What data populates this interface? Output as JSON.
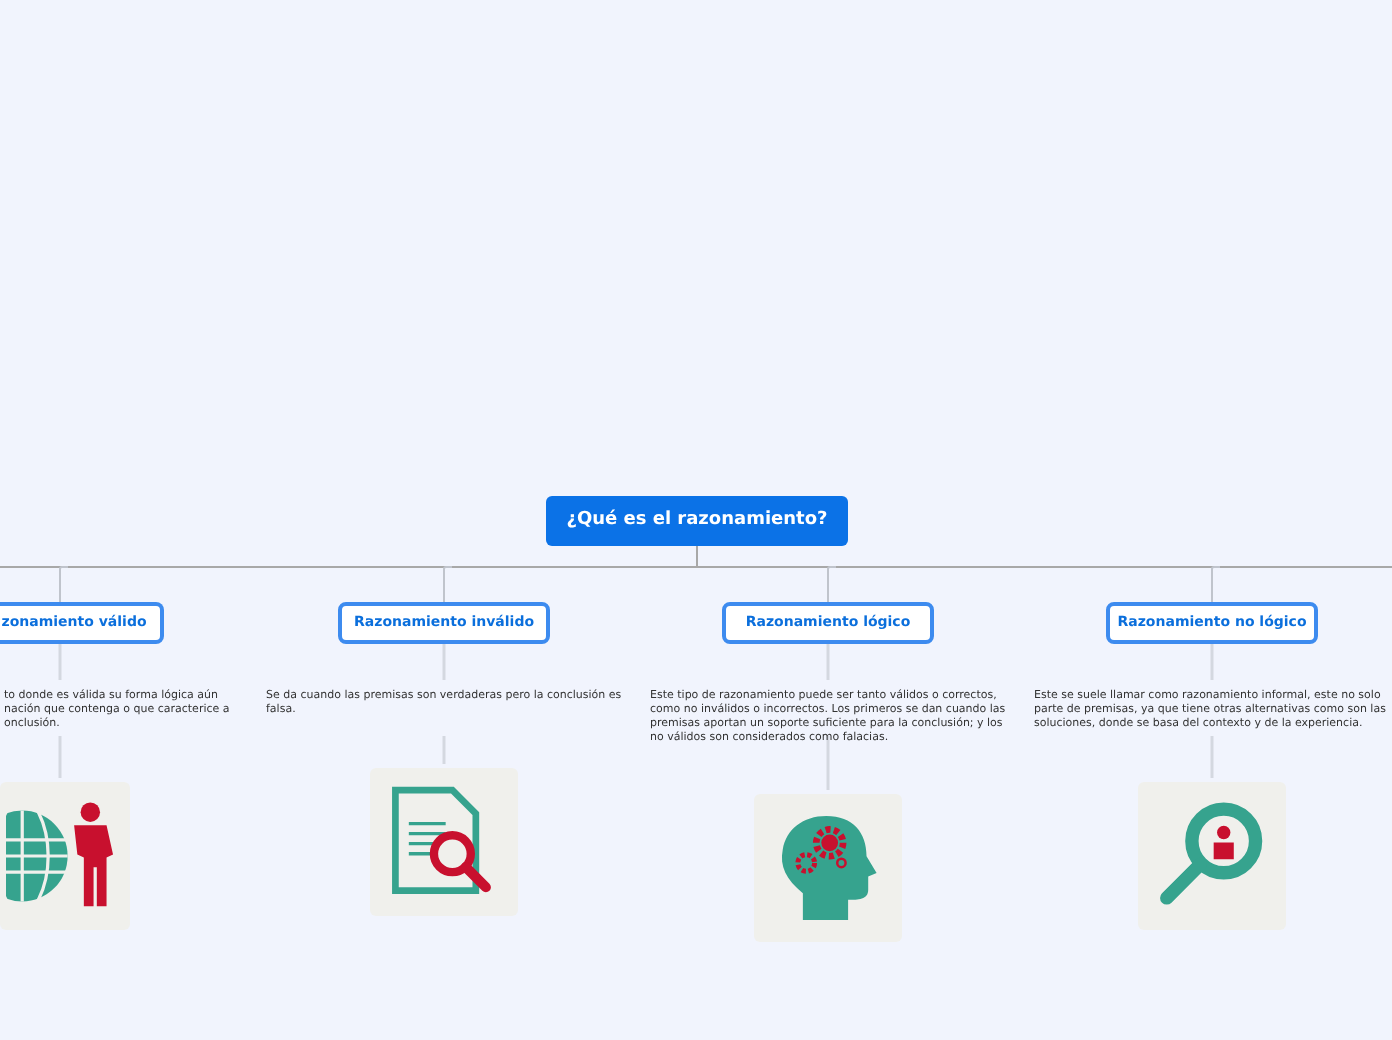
{
  "root": {
    "title": "¿Qué es el razonamiento?"
  },
  "branches": [
    {
      "title": "zonamiento válido",
      "description": "to donde es válida su forma lógica aún\nnación que contenga o que caracterice a\nonclusión.",
      "kind": "globe-person"
    },
    {
      "title": "Razonamiento inválido",
      "description": "Se da cuando las premisas son verdaderas pero la conclusión es falsa.",
      "kind": "document-search"
    },
    {
      "title": "Razonamiento lógico",
      "description": "Este tipo de razonamiento puede ser tanto válidos o correctos, como no inválidos o incorrectos. Los primeros se dan cuando las premisas aportan un soporte suficiente para la conclusión; y los no válidos son considerados como falacias.",
      "kind": "head-gears"
    },
    {
      "title": "Razonamiento no lógico",
      "description": "Este se suele llamar como razonamiento informal, este no solo parte de premisas, ya que tiene otras alternativas como son las soluciones, donde se basa del contexto y de la experiencia.",
      "kind": "person-search"
    }
  ]
}
